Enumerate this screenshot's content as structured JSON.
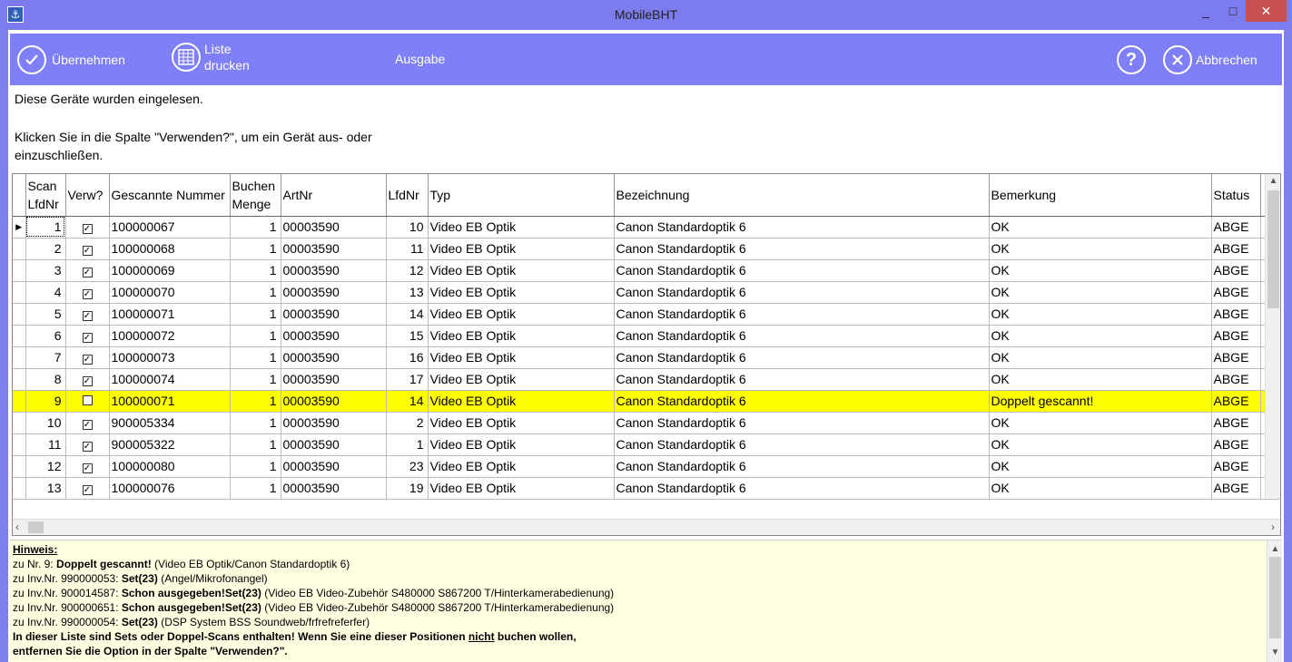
{
  "window": {
    "title": "MobileBHT",
    "minimize": "_",
    "maximize": "□",
    "close": "✕"
  },
  "toolbar": {
    "apply_label": "Übernehmen",
    "print_label_1": "Liste",
    "print_label_2": "drucken",
    "output_label": "Ausgabe",
    "help_glyph": "?",
    "cancel_label": "Abbrechen"
  },
  "intro": {
    "line1": "Diese Geräte wurden eingelesen.",
    "line2": "Klicken Sie in die Spalte \"Verwenden?\", um ein Gerät aus- oder einzuschließen."
  },
  "table": {
    "headers": {
      "scan": "Scan LfdNr",
      "verw": "Verw?",
      "gescannte": "Gescannte Nummer",
      "buchen": "Buchen Menge",
      "artnr": "ArtNr",
      "lfdnr": "LfdNr",
      "typ": "Typ",
      "bezeichnung": "Bezeichnung",
      "bemerkung": "Bemerkung",
      "status": "Status"
    },
    "rows": [
      {
        "scan": "1",
        "checked": true,
        "nummer": "100000067",
        "menge": "1",
        "artnr": "00003590",
        "lfdnr": "10",
        "typ": "Video EB Optik",
        "bez": "Canon Standardoptik 6",
        "bem": "OK",
        "status": "ABGE"
      },
      {
        "scan": "2",
        "checked": true,
        "nummer": "100000068",
        "menge": "1",
        "artnr": "00003590",
        "lfdnr": "11",
        "typ": "Video EB Optik",
        "bez": "Canon Standardoptik 6",
        "bem": "OK",
        "status": "ABGE"
      },
      {
        "scan": "3",
        "checked": true,
        "nummer": "100000069",
        "menge": "1",
        "artnr": "00003590",
        "lfdnr": "12",
        "typ": "Video EB Optik",
        "bez": "Canon Standardoptik 6",
        "bem": "OK",
        "status": "ABGE"
      },
      {
        "scan": "4",
        "checked": true,
        "nummer": "100000070",
        "menge": "1",
        "artnr": "00003590",
        "lfdnr": "13",
        "typ": "Video EB Optik",
        "bez": "Canon Standardoptik 6",
        "bem": "OK",
        "status": "ABGE"
      },
      {
        "scan": "5",
        "checked": true,
        "nummer": "100000071",
        "menge": "1",
        "artnr": "00003590",
        "lfdnr": "14",
        "typ": "Video EB Optik",
        "bez": "Canon Standardoptik 6",
        "bem": "OK",
        "status": "ABGE"
      },
      {
        "scan": "6",
        "checked": true,
        "nummer": "100000072",
        "menge": "1",
        "artnr": "00003590",
        "lfdnr": "15",
        "typ": "Video EB Optik",
        "bez": "Canon Standardoptik 6",
        "bem": "OK",
        "status": "ABGE"
      },
      {
        "scan": "7",
        "checked": true,
        "nummer": "100000073",
        "menge": "1",
        "artnr": "00003590",
        "lfdnr": "16",
        "typ": "Video EB Optik",
        "bez": "Canon Standardoptik 6",
        "bem": "OK",
        "status": "ABGE"
      },
      {
        "scan": "8",
        "checked": true,
        "nummer": "100000074",
        "menge": "1",
        "artnr": "00003590",
        "lfdnr": "17",
        "typ": "Video EB Optik",
        "bez": "Canon Standardoptik 6",
        "bem": "OK",
        "status": "ABGE"
      },
      {
        "scan": "9",
        "checked": false,
        "highlight": true,
        "nummer": "100000071",
        "menge": "1",
        "artnr": "00003590",
        "lfdnr": "14",
        "typ": "Video EB Optik",
        "bez": "Canon Standardoptik 6",
        "bem": "Doppelt gescannt!",
        "status": "ABGE"
      },
      {
        "scan": "10",
        "checked": true,
        "nummer": "900005334",
        "menge": "1",
        "artnr": "00003590",
        "lfdnr": "2",
        "typ": "Video EB Optik",
        "bez": "Canon Standardoptik 6",
        "bem": "OK",
        "status": "ABGE"
      },
      {
        "scan": "11",
        "checked": true,
        "nummer": "900005322",
        "menge": "1",
        "artnr": "00003590",
        "lfdnr": "1",
        "typ": "Video EB Optik",
        "bez": "Canon Standardoptik 6",
        "bem": "OK",
        "status": "ABGE"
      },
      {
        "scan": "12",
        "checked": true,
        "nummer": "100000080",
        "menge": "1",
        "artnr": "00003590",
        "lfdnr": "23",
        "typ": "Video EB Optik",
        "bez": "Canon Standardoptik 6",
        "bem": "OK",
        "status": "ABGE"
      },
      {
        "scan": "13",
        "checked": true,
        "nummer": "100000076",
        "menge": "1",
        "artnr": "00003590",
        "lfdnr": "19",
        "typ": "Video EB Optik",
        "bez": "Canon Standardoptik 6",
        "bem": "OK",
        "status": "ABGE"
      }
    ]
  },
  "hint": {
    "title": "Hinweis:",
    "lines": [
      {
        "prefix": "zu Nr. 9: ",
        "bold": "Doppelt gescannt!",
        "rest": " (Video EB Optik/Canon Standardoptik 6)"
      },
      {
        "prefix": "zu Inv.Nr. 990000053: ",
        "bold": "Set(23)",
        "rest": " (Angel/Mikrofonangel)"
      },
      {
        "prefix": "zu Inv.Nr. 900014587: ",
        "bold": "Schon ausgegeben!Set(23)",
        "rest": " (Video EB Video-Zubehör S480000 S867200 T/Hinterkamerabedienung)"
      },
      {
        "prefix": "zu Inv.Nr. 900000651: ",
        "bold": "Schon ausgegeben!Set(23)",
        "rest": " (Video EB Video-Zubehör S480000 S867200 T/Hinterkamerabedienung)"
      },
      {
        "prefix": "zu Inv.Nr. 990000054: ",
        "bold": "Set(23)",
        "rest": " (DSP System BSS Soundweb/frfrefreferfer)"
      }
    ],
    "warning1_a": "In dieser Liste sind Sets oder Doppel-Scans enthalten! Wenn Sie eine dieser Positionen ",
    "warning1_u": "nicht",
    "warning1_b": " buchen wollen,",
    "warning2": "entfernen Sie die Option in der Spalte \"Verwenden?\"."
  },
  "colors": {
    "toolbar": "#7f7ff7",
    "highlight": "#ffff00",
    "hint_bg": "#ffffe1",
    "close": "#c75050"
  },
  "icons": [
    "app-icon",
    "checkmark-circle-icon",
    "grid-list-icon",
    "help-circle-icon",
    "x-circle-icon",
    "row-pointer-icon"
  ]
}
